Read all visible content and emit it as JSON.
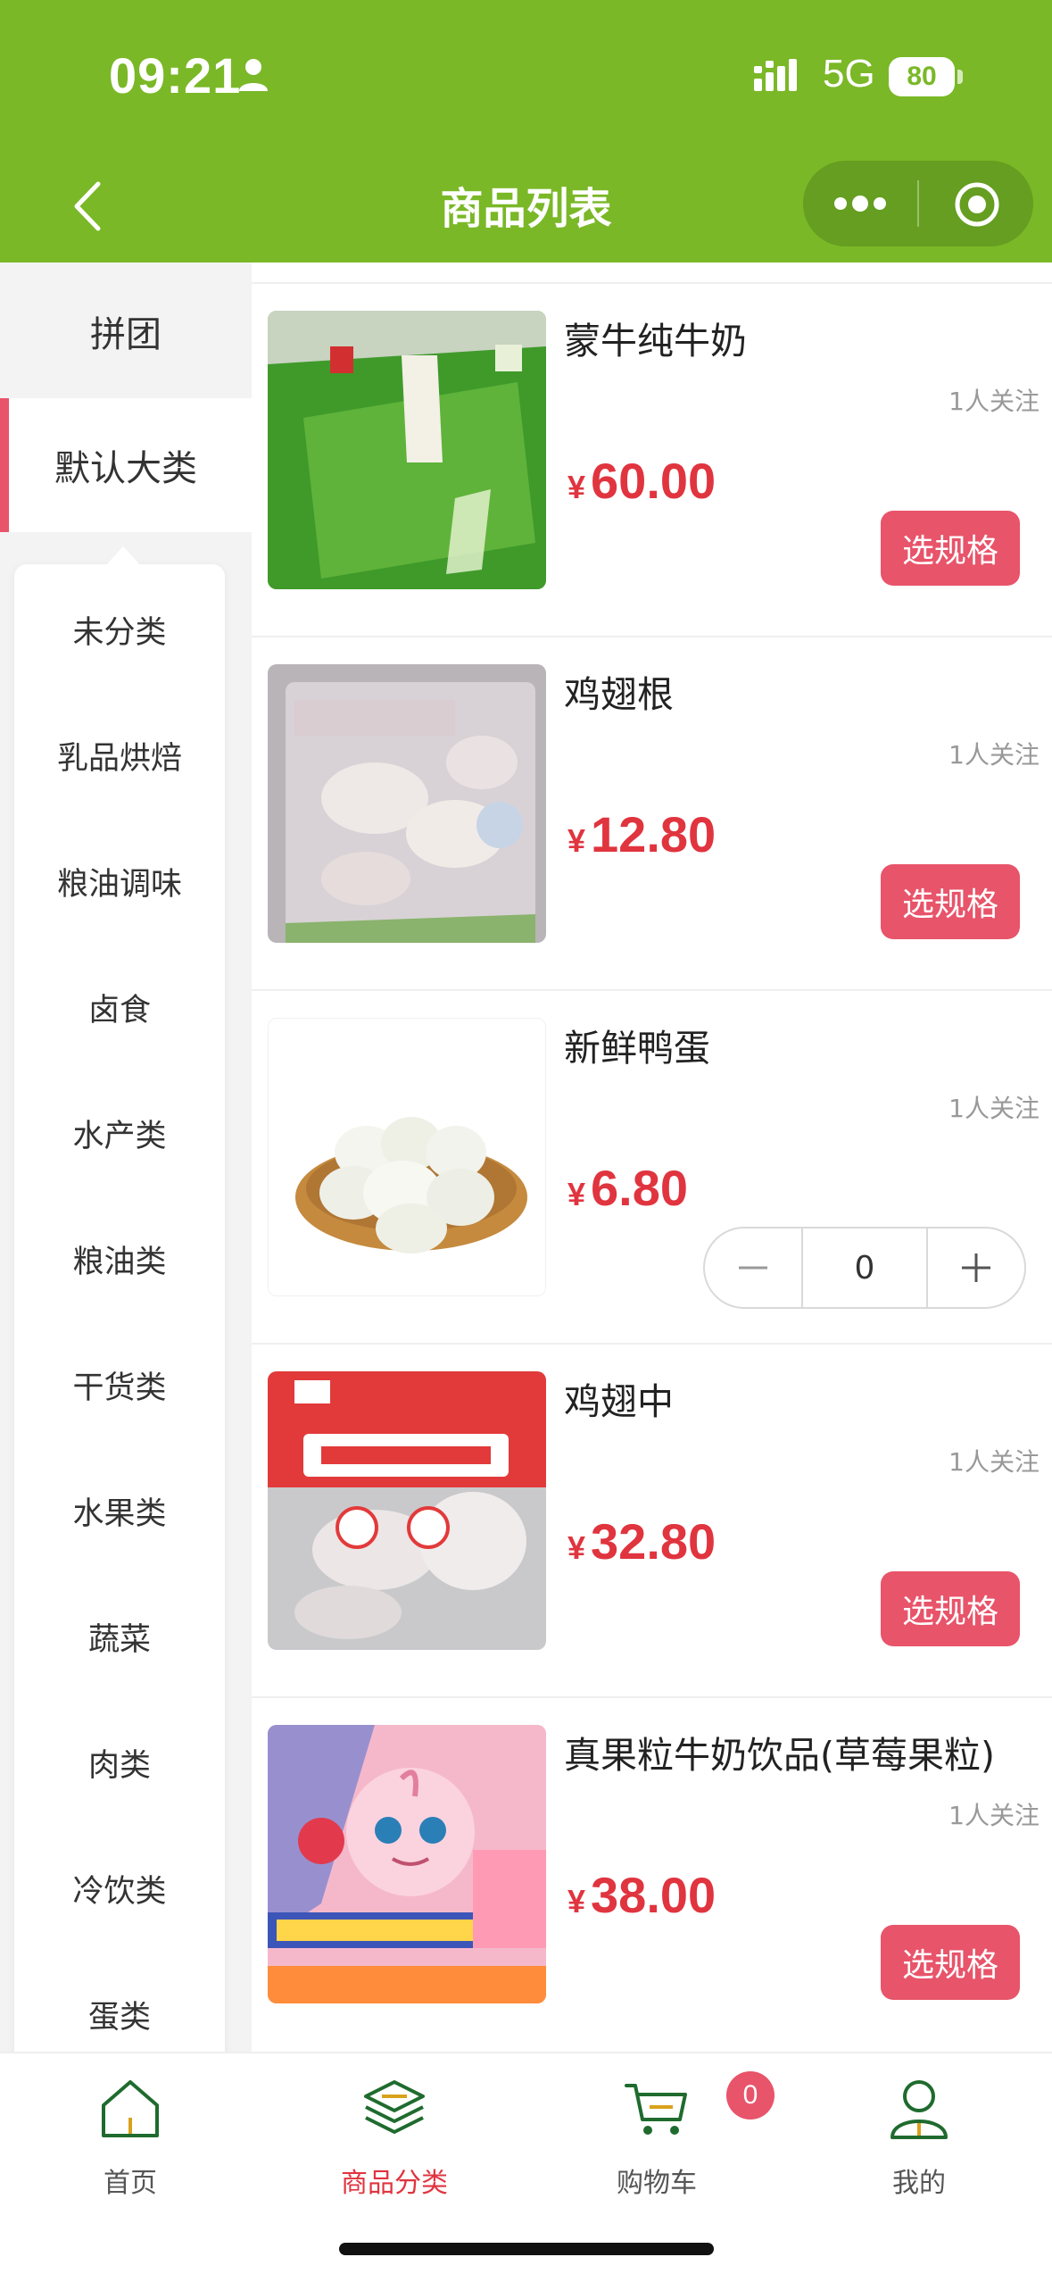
{
  "status_bar": {
    "time": "09:21",
    "network": "5G",
    "battery": "80"
  },
  "header": {
    "title": "商品列表"
  },
  "sidebar": {
    "top_items": [
      {
        "label": "拼团"
      },
      {
        "label": "默认大类"
      }
    ],
    "sub_items": [
      {
        "label": "未分类"
      },
      {
        "label": "乳品烘焙"
      },
      {
        "label": "粮油调味"
      },
      {
        "label": "卤食"
      },
      {
        "label": "水产类"
      },
      {
        "label": "粮油类"
      },
      {
        "label": "干货类"
      },
      {
        "label": "水果类"
      },
      {
        "label": "蔬菜"
      },
      {
        "label": "肉类"
      },
      {
        "label": "冷饮类"
      },
      {
        "label": "蛋类"
      }
    ]
  },
  "products": [
    {
      "name": "蒙牛纯牛奶",
      "followers": "1人关注",
      "currency": "¥",
      "price": "60.00",
      "action": "选规格"
    },
    {
      "name": "鸡翅根",
      "followers": "1人关注",
      "currency": "¥",
      "price": "12.80",
      "action": "选规格"
    },
    {
      "name": "新鲜鸭蛋",
      "followers": "1人关注",
      "currency": "¥",
      "price": "6.80",
      "quantity": "0"
    },
    {
      "name": "鸡翅中",
      "followers": "1人关注",
      "currency": "¥",
      "price": "32.80",
      "action": "选规格"
    },
    {
      "name": "真果粒牛奶饮品(草莓果粒)",
      "followers": "1人关注",
      "currency": "¥",
      "price": "38.00",
      "action": "选规格"
    }
  ],
  "tabbar": {
    "items": [
      {
        "label": "首页",
        "icon": "home-icon"
      },
      {
        "label": "商品分类",
        "icon": "layers-icon"
      },
      {
        "label": "购物车",
        "icon": "cart-icon"
      },
      {
        "label": "我的",
        "icon": "user-icon"
      }
    ],
    "cart_badge": "0"
  },
  "colors": {
    "header": "#7ab827",
    "accent": "#e8546a",
    "price": "#e0343f",
    "icon_green": "#1f6b2e"
  }
}
